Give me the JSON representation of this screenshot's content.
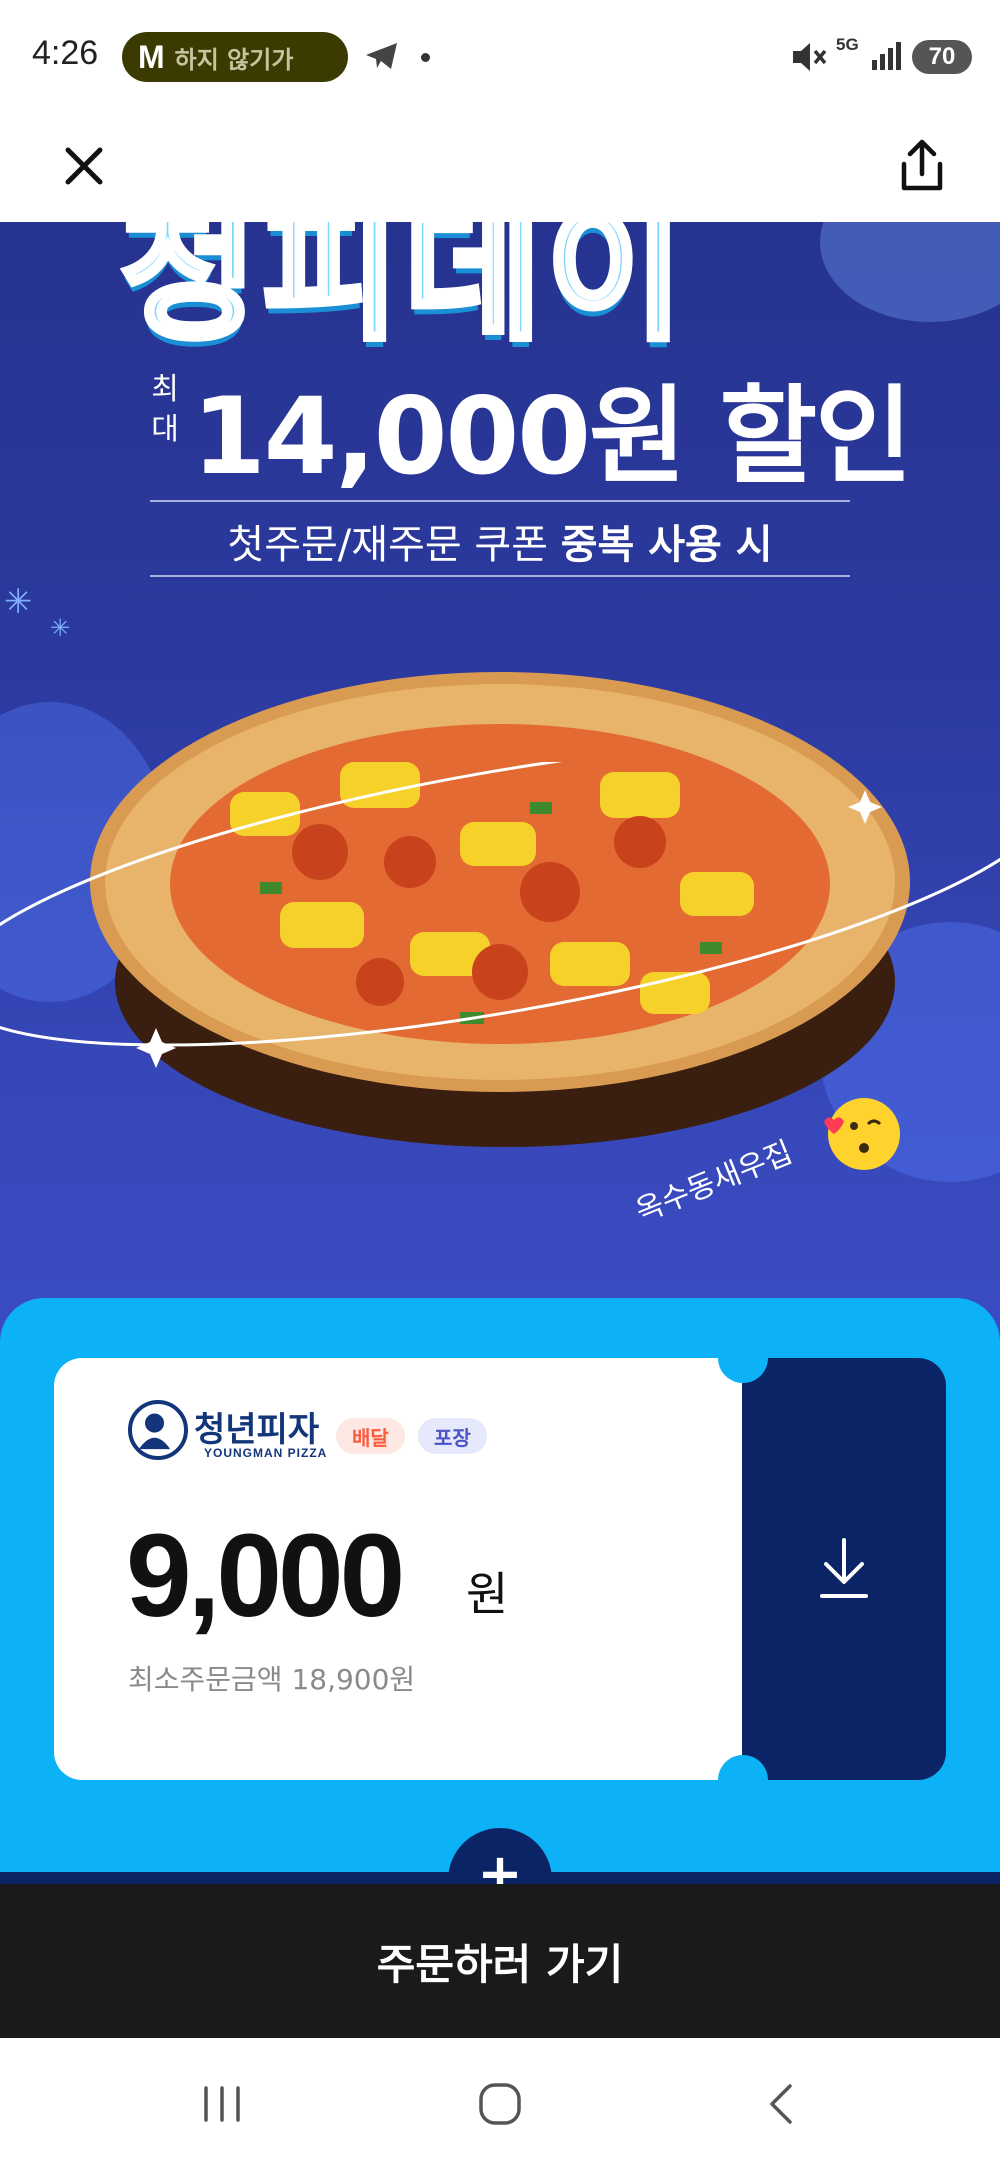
{
  "status_bar": {
    "time": "4:26",
    "notification_app_letter": "M",
    "notification_text": "하지 않기가",
    "network": "5G",
    "battery": "70"
  },
  "banner": {
    "title": "청피데이",
    "discount_prefix": "최대",
    "discount_amount": "14,000원 할인",
    "coupon_note_regular": "첫주문/재주문 쿠폰 ",
    "coupon_note_bold": "중복 사용 시",
    "handwriting": "옥수동새우집"
  },
  "coupon": {
    "brand_name": "청년피자",
    "brand_sub": "YOUNGMAN PIZZA",
    "tag_delivery": "배달",
    "tag_pickup": "포장",
    "amount": "9,000",
    "amount_unit": "원",
    "min_order": "최소주문금액 18,900원",
    "plus_symbol": "+"
  },
  "order_button": {
    "label": "주문하러 가기"
  },
  "colors": {
    "banner_bg": "#2c3aa0",
    "coupon_section_bg": "#0cb2f5",
    "coupon_download_bg": "#0b2466",
    "order_bar_bg": "#1a1a1a",
    "tag_delivery": "#ff5a3c",
    "tag_pickup": "#4a53c7"
  }
}
